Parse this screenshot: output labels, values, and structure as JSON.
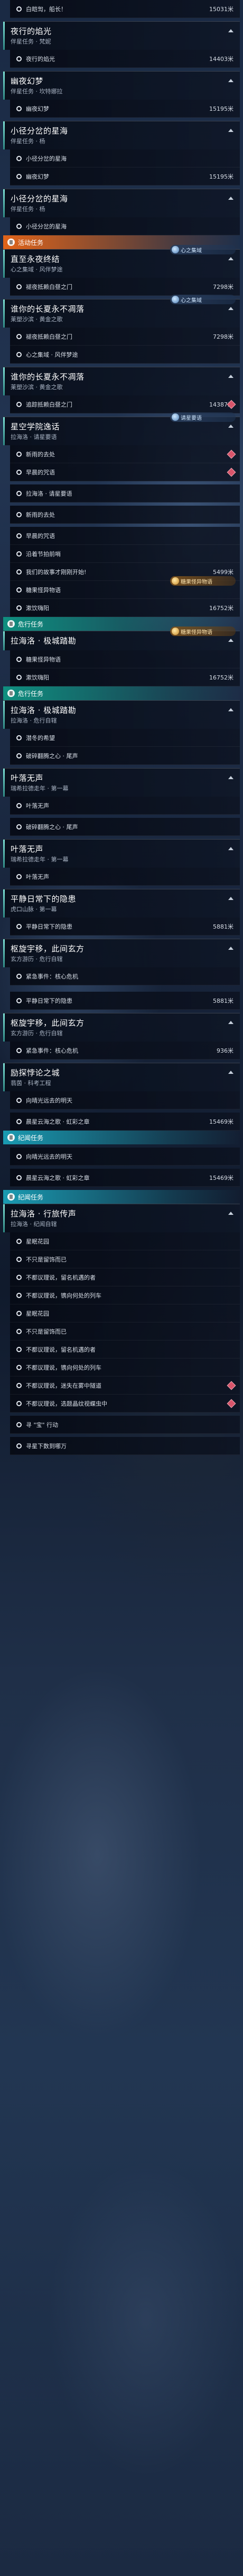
{
  "blocks": [
    {
      "t": "obj",
      "label": "白皑訇，船长！",
      "dist": "15031米"
    },
    {
      "t": "sp"
    },
    {
      "t": "head",
      "title": "夜行的焰光",
      "sub": "伴星任务 · 梵妮"
    },
    {
      "t": "obj",
      "label": "夜行的焰光",
      "dist": "14403米"
    },
    {
      "t": "sp"
    },
    {
      "t": "head",
      "title": "幽夜幻梦",
      "sub": "伴星任务 · 坎特娜拉"
    },
    {
      "t": "obj",
      "label": "幽夜幻梦",
      "dist": "15195米"
    },
    {
      "t": "sp"
    },
    {
      "t": "head",
      "title": "小径分岔的星海",
      "sub": "伴星任务 · 杨"
    },
    {
      "t": "obj",
      "label": "小径分岔的星海",
      "dist": ""
    },
    {
      "t": "obj",
      "label": "幽夜幻梦",
      "dist": "15195米"
    },
    {
      "t": "sp"
    },
    {
      "t": "head",
      "title": "小径分岔的星海",
      "sub": "伴星任务 · 杨"
    },
    {
      "t": "obj",
      "label": "小径分岔的星海",
      "dist": ""
    },
    {
      "t": "sec",
      "color": "orange",
      "label": "活动任务"
    },
    {
      "t": "head",
      "title": "直至永夜终结",
      "sub": "心之集域 · 风伴梦途",
      "pin": "心之集域",
      "pin_color": "blue"
    },
    {
      "t": "obj",
      "label": "褪夜抵赖白昼之门",
      "dist": "7298米"
    },
    {
      "t": "sp"
    },
    {
      "t": "head",
      "title": "谁你的长夏永不凋落",
      "sub": "莱塑沙滨 · 黄金之歌",
      "pin": "心之集域",
      "pin_color": "blue"
    },
    {
      "t": "obj",
      "label": "褪夜抵赖白昼之门",
      "dist": "7298米"
    },
    {
      "t": "obj",
      "label": "心之集域 · 风伴梦途",
      "dist": ""
    },
    {
      "t": "sp"
    },
    {
      "t": "head",
      "title": "谁你的长夏永不凋落",
      "sub": "莱塑沙滨 · 黄金之歌"
    },
    {
      "t": "obj",
      "label": "追踪抵赖白昼之门",
      "dist": "14387米",
      "marker": true
    },
    {
      "t": "sp"
    },
    {
      "t": "head",
      "title": "星空学院逸话",
      "sub": "拉海洛 · 请星要语",
      "pin": "请星要语",
      "pin_color": "blue"
    },
    {
      "t": "obj",
      "label": "新雨的去处",
      "dist": "",
      "marker": true
    },
    {
      "t": "obj",
      "label": "早晨的咒语",
      "dist": "",
      "marker": true
    },
    {
      "t": "sp"
    },
    {
      "t": "obj",
      "label": "拉海洛 · 请星要语",
      "dist": ""
    },
    {
      "t": "sp"
    },
    {
      "t": "obj",
      "label": "新雨的去处",
      "dist": ""
    },
    {
      "t": "sp"
    },
    {
      "t": "obj",
      "label": "早晨的咒语",
      "dist": ""
    },
    {
      "t": "obj",
      "label": "沿着节拍前哨",
      "dist": ""
    },
    {
      "t": "obj",
      "label": "我们的故事才刚刚开始!",
      "dist": "5499米"
    },
    {
      "t": "obj",
      "label": "糖果怪异物语",
      "dist": "",
      "pin": "糖果怪异物语",
      "pin_color": "gold"
    },
    {
      "t": "obj",
      "label": "漱饮嗨阳",
      "dist": "16752米"
    },
    {
      "t": "sec",
      "color": "teal",
      "label": "危行任务"
    },
    {
      "t": "head",
      "title": "拉海洛 · 极城踏勘",
      "sub": "",
      "pin": "糖果怪异物语",
      "pin_color": "gold"
    },
    {
      "t": "obj",
      "label": "糖果怪异物语",
      "dist": ""
    },
    {
      "t": "obj",
      "label": "漱饮嗨阳",
      "dist": "16752米"
    },
    {
      "t": "sec",
      "color": "teal",
      "label": "危行任务"
    },
    {
      "t": "head",
      "title": "拉海洛 · 极城踏勘",
      "sub": "拉海洛 · 危行自辖"
    },
    {
      "t": "obj",
      "label": "潜冬的希望",
      "dist": ""
    },
    {
      "t": "obj",
      "label": "破碎翻腾之心 · 尾声",
      "dist": ""
    },
    {
      "t": "sp"
    },
    {
      "t": "head",
      "title": "叶落无声",
      "sub": "瑞希拉德走年 · 第一幕"
    },
    {
      "t": "obj",
      "label": "叶落无声",
      "dist": ""
    },
    {
      "t": "sp"
    },
    {
      "t": "obj",
      "label": "破碎翻腾之心 · 尾声",
      "dist": ""
    },
    {
      "t": "sp"
    },
    {
      "t": "head",
      "title": "叶落无声",
      "sub": "瑞希拉德走年 · 第一幕"
    },
    {
      "t": "obj",
      "label": "叶落无声",
      "dist": ""
    },
    {
      "t": "sp"
    },
    {
      "t": "head",
      "title": "平静日常下的隐患",
      "sub": "虎口山脉 · 第一幕"
    },
    {
      "t": "obj",
      "label": "平静日常下的隐患",
      "dist": "5881米"
    },
    {
      "t": "sp"
    },
    {
      "t": "head",
      "title": "枢旋宇移，此间玄方",
      "sub": "玄方游历 · 危行自辖"
    },
    {
      "t": "obj",
      "label": "紧急事件：核心危机",
      "dist": ""
    },
    {
      "t": "sp"
    },
    {
      "t": "sp"
    },
    {
      "t": "obj",
      "label": "平静日常下的隐患",
      "dist": "5881米"
    },
    {
      "t": "sp"
    },
    {
      "t": "head",
      "title": "枢旋宇移，此间玄方",
      "sub": "玄方游历 · 危行自辖"
    },
    {
      "t": "obj",
      "label": "紧急事件：核心危机",
      "dist": "936米"
    },
    {
      "t": "sp"
    },
    {
      "t": "head",
      "title": "励探悖论之城",
      "sub": "翡茵 · 科考工程"
    },
    {
      "t": "obj",
      "label": "向晴光远去的明天",
      "dist": ""
    },
    {
      "t": "sp"
    },
    {
      "t": "obj",
      "label": "晨星云海之歌 · 虹彩之章",
      "dist": "15469米"
    },
    {
      "t": "sec",
      "color": "cyan",
      "label": "纪闻任务"
    },
    {
      "t": "sp"
    },
    {
      "t": "obj",
      "label": "向晴光远去的明天",
      "dist": ""
    },
    {
      "t": "sp"
    },
    {
      "t": "obj",
      "label": "晨星云海之歌 · 虹彩之章",
      "dist": "15469米"
    },
    {
      "t": "sp"
    },
    {
      "t": "sec",
      "color": "cyan",
      "label": "纪闻任务"
    },
    {
      "t": "head",
      "title": "拉海洛 · 行旅传声",
      "sub": "拉海洛 · 纪闻自辖"
    },
    {
      "t": "obj",
      "label": "星眠花园",
      "dist": ""
    },
    {
      "t": "obj",
      "label": "不只是留饰而已",
      "dist": ""
    },
    {
      "t": "obj",
      "label": "不都议理说，留名机遇的者",
      "dist": ""
    },
    {
      "t": "obj",
      "label": "不都议理说，镌向何处的列车",
      "dist": ""
    },
    {
      "t": "obj",
      "label": "星眠花园",
      "dist": ""
    },
    {
      "t": "obj",
      "label": "不只是留饰而已",
      "dist": ""
    },
    {
      "t": "obj",
      "label": "不都议理说，留名机遇的者",
      "dist": ""
    },
    {
      "t": "obj",
      "label": "不都议理说，镌向何处的列车",
      "dist": ""
    },
    {
      "t": "obj",
      "label": "不都议理说，迷失在雾中隧道",
      "dist": "",
      "marker": true
    },
    {
      "t": "obj",
      "label": "不都议理说，选题晶纹视蝶虫中",
      "dist": "",
      "marker": true
    },
    {
      "t": "sp"
    },
    {
      "t": "obj",
      "label": "寻 \"宝\" 行动",
      "dist": ""
    },
    {
      "t": "sp"
    },
    {
      "t": "obj",
      "label": "寻星下数到哪万",
      "dist": ""
    }
  ]
}
